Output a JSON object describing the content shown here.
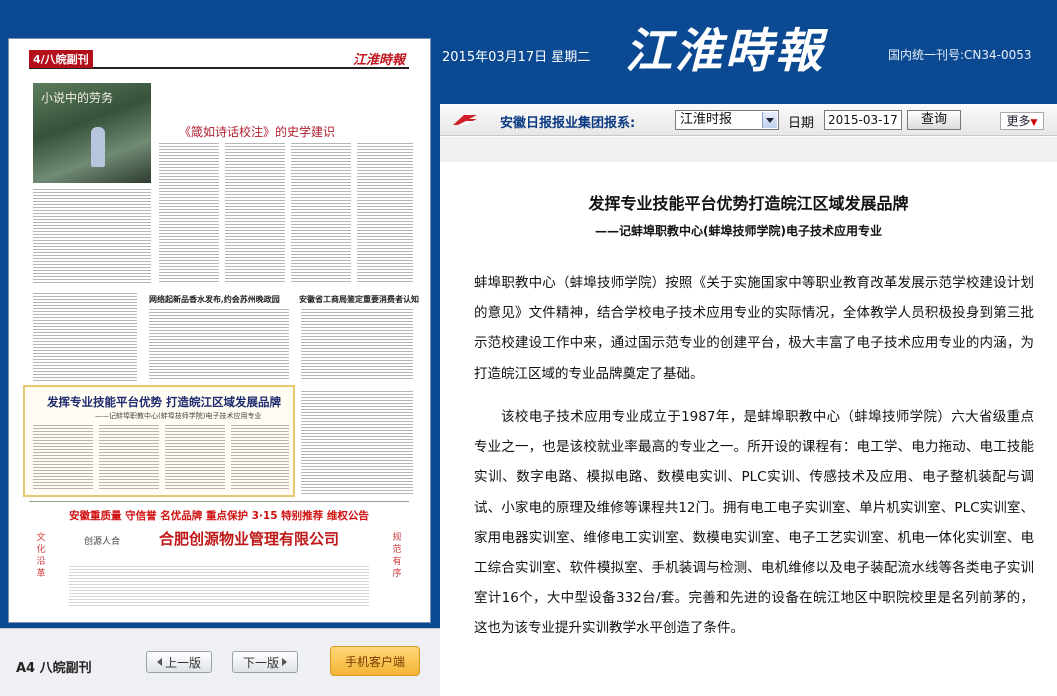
{
  "header": {
    "date_text": "2015年03月17日  星期二",
    "masthead": "江淮時報",
    "cn_number": "国内统一刊号:CN34-0053"
  },
  "toolbar": {
    "group_label": "安徽日报报业集团报系:",
    "paper_select_value": "江淮时报",
    "date_label": "日期",
    "date_value": "2015-03-17",
    "query_button": "查询",
    "more_button": "更多"
  },
  "newspaper_page": {
    "page_tag": "4/八皖副刊",
    "masthead": "江淮時報",
    "photo_caption": "小说中的劳务",
    "headline_poem": "《箴如诗话校注》的史学建识",
    "headline_left": "网络起新品香水发布,约会苏州晚政园",
    "headline_right": "安徽省工商局鉴定重要消费者认知",
    "highlight_title": "发挥专业技能平台优势 打造皖江区域发展品牌",
    "highlight_sub": "——记蚌埠职教中心(蚌埠技师学院)电子技术应用专业",
    "ad_top": "安徽重质量 守信誉 名优品牌 重点保护 3·15 特别推荐 维权公告",
    "ad_main": "合肥创源物业管理有限公司",
    "ad_logo": "创源人合",
    "ad_side_left": "文化沿革",
    "ad_side_right": "规范有序"
  },
  "left_footer": {
    "section_label": "A4  八皖副刊",
    "prev_button": "上一版",
    "next_button": "下一版",
    "mobile_button": "手机客户端"
  },
  "article": {
    "title": "发挥专业技能平台优势打造皖江区域发展品牌",
    "subtitle": "——记蚌埠职教中心(蚌埠技师学院)电子技术应用专业",
    "paragraph_1": "蚌埠职教中心（蚌埠技师学院）按照《关于实施国家中等职业教育改革发展示范学校建设计划的意见》文件精神，结合学校电子技术应用专业的实际情况，全体教学人员积极投身到第三批示范校建设工作中来，通过国示范专业的创建平台，极大丰富了电子技术应用专业的内涵，为打造皖江区域的专业品牌奠定了基础。",
    "paragraph_2": "该校电子技术应用专业成立于1987年，是蚌埠职教中心（蚌埠技师学院）六大省级重点专业之一，也是该校就业率最高的专业之一。所开设的课程有：电工学、电力拖动、电工技能实训、数字电路、模拟电路、数模电实训、PLC实训、传感技术及应用、电子整机装配与调试、小家电的原理及维修等课程共12门。拥有电工电子实训室、单片机实训室、PLC实训室、家用电器实训室、维修电工实训室、数模电实训室、电子工艺实训室、机电一体化实训室、电工综合实训室、软件模拟室、手机装调与检测、电机维修以及电子装配流水线等各类电子实训室计16个，大中型设备332台/套。完善和先进的设备在皖江地区中职院校里是名列前茅的，这也为该专业提升实训教学水平创造了条件。"
  },
  "colors": {
    "brand_blue": "#0b4a92",
    "accent_red": "#c01620",
    "mobile_button": "#f5b336"
  }
}
